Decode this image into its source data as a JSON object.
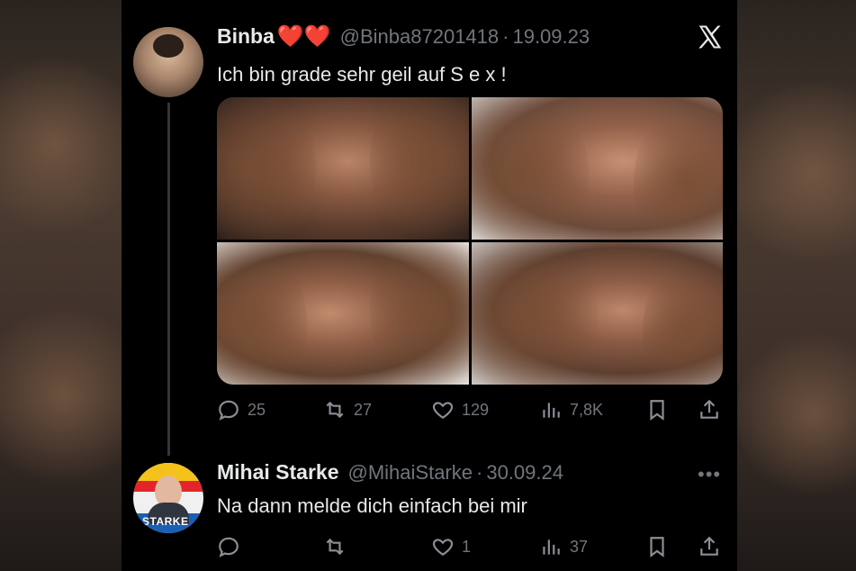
{
  "tweet1": {
    "display_name": "Binba",
    "hearts": "❤️❤️",
    "handle": "@Binba87201418",
    "separator": "·",
    "date": "19.09.23",
    "text": "Ich bin grade sehr geil auf  S e x !",
    "photos": [
      "photo-1",
      "photo-2",
      "photo-3",
      "photo-4"
    ],
    "actions": {
      "replies": "25",
      "retweets": "27",
      "likes": "129",
      "views": "7,8K"
    }
  },
  "tweet2": {
    "display_name": "Mihai Starke",
    "handle": "@MihaiStarke",
    "separator": "·",
    "date": "30.09.24",
    "text": "Na dann melde dich einfach bei mir",
    "avatar_label": "STARKE",
    "more": "•••",
    "actions": {
      "replies": "",
      "retweets": "",
      "likes": "1",
      "views": "37"
    }
  },
  "icons": [
    "x-logo-icon",
    "reply-icon",
    "retweet-icon",
    "like-icon",
    "views-icon",
    "bookmark-icon",
    "share-icon",
    "more-icon"
  ],
  "colors": {
    "background": "#000000",
    "text": "#e7e9ea",
    "muted": "#71767b",
    "heart": "#f91f2f"
  }
}
